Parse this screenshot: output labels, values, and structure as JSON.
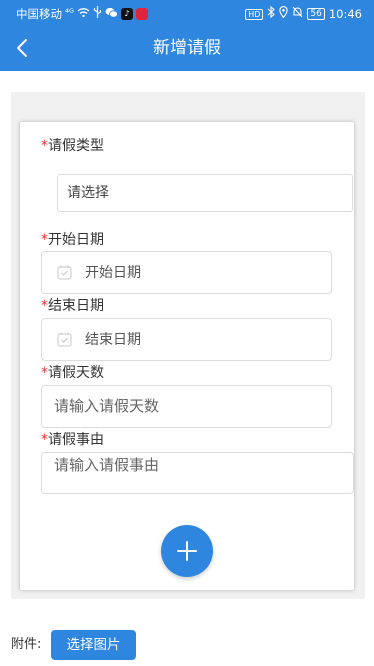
{
  "status_bar": {
    "carrier": "中国移动",
    "signal": "⁴ᴳ",
    "hd": "HD",
    "battery": "56",
    "time": "10:46",
    "icons": [
      "wifi-icon",
      "usb-icon",
      "wechat-icon",
      "tiktok-icon",
      "app-icon",
      "bluetooth-icon",
      "location-icon",
      "mute-icon",
      "battery-icon"
    ]
  },
  "header": {
    "title": "新增请假",
    "back_icon": "chevron-left-icon"
  },
  "form": {
    "required_mark": "*",
    "leave_type_label": "请假类型",
    "leave_type_value": "请选择",
    "start_date_label": "开始日期",
    "start_date_placeholder": "开始日期",
    "end_date_label": "结束日期",
    "end_date_placeholder": "结束日期",
    "days_label": "请假天数",
    "days_placeholder": "请输入请假天数",
    "reason_label": "请假事由",
    "reason_placeholder": "请输入请假事由",
    "add_icon": "plus-icon"
  },
  "attachment": {
    "label": "附件:",
    "button_label": "选择图片"
  },
  "colors": {
    "primary": "#2f86de",
    "required": "#e53935",
    "panel_bg": "#f0f0f0"
  }
}
